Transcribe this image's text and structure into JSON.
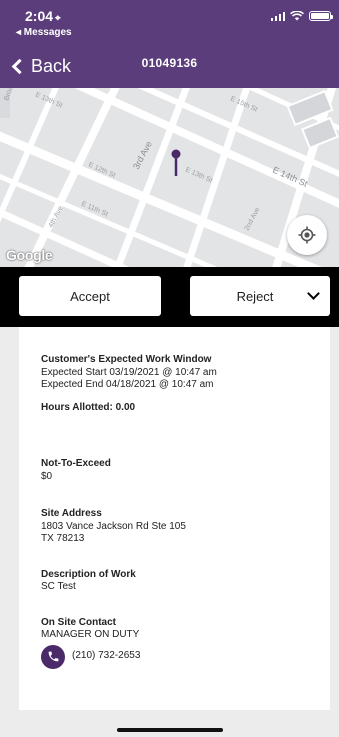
{
  "status_bar": {
    "time": "2:04",
    "location_arrow": "⌖",
    "back_app_label": "◂ Messages"
  },
  "nav": {
    "back_label": "Back",
    "title": "01049136"
  },
  "map": {
    "streets": [
      "E 13th St",
      "E 15th St",
      "E 12th St",
      "3rd Ave",
      "E 13th St",
      "E 14th St",
      "4th Ave",
      "E 11th St",
      "2nd Ave",
      "Broa"
    ],
    "attribution": "Google",
    "pin_color": "#4b2a6a"
  },
  "actions": {
    "accept_label": "Accept",
    "reject_label": "Reject"
  },
  "details": {
    "work_window_label": "Customer's Expected Work Window",
    "expected_start": "Expected Start 03/19/2021 @ 10:47 am",
    "expected_end": "Expected End 04/18/2021 @ 10:47 am",
    "hours_allotted": "Hours Allotted: 0.00",
    "nte_label": "Not-To-Exceed",
    "nte_value": "$0",
    "site_address_label": "Site Address",
    "site_address_line1": "1803 Vance Jackson Rd Ste 105",
    "site_address_line2": "TX 78213",
    "description_label": "Description of Work",
    "description_value": "SC Test",
    "contact_label": "On Site Contact",
    "contact_name": "MANAGER ON DUTY",
    "contact_phone": "(210) 732-2653"
  },
  "colors": {
    "header": "#5b3d7b",
    "phone_button": "#4b2a6a",
    "action_bar": "#000000"
  }
}
